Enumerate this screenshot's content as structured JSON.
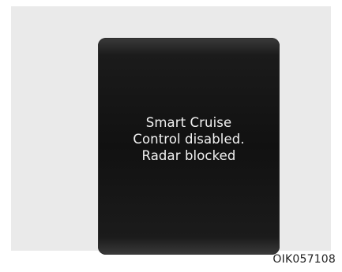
{
  "display": {
    "message_lines": [
      "Smart Cruise",
      "Control disabled.",
      "Radar blocked"
    ]
  },
  "figure_code": "OIK057108",
  "colors": {
    "frame_background": "#eaeaea",
    "display_background": "#111111",
    "message_text": "#f2f2f2"
  }
}
